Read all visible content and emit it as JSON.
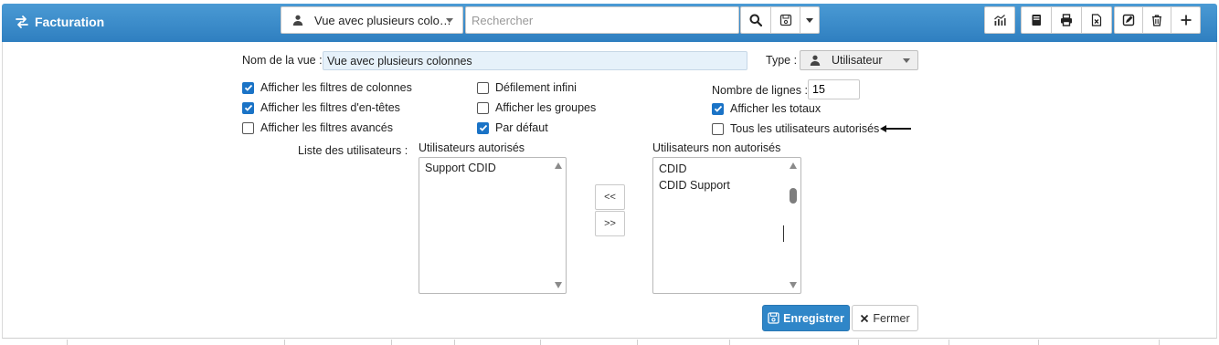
{
  "header": {
    "title": "Facturation",
    "view_selected": "Vue avec plusieurs colo…",
    "search_placeholder": "Rechercher",
    "icons": [
      "swap-arrows-icon",
      "user-icon",
      "search-icon",
      "save-view-icon",
      "chevron-down-icon",
      "chart-icon",
      "book-icon",
      "print-icon",
      "excel-export-icon",
      "edit-icon",
      "trash-icon",
      "plus-icon"
    ]
  },
  "form": {
    "view_name_label": "Nom de la vue :",
    "view_name_value": "Vue avec plusieurs colonnes",
    "type_label": "Type :",
    "type_value": "Utilisateur",
    "rows_label": "Nombre de lignes :",
    "rows_value": "15",
    "checkboxes_col1": [
      {
        "label": "Afficher les filtres de colonnes",
        "checked": true
      },
      {
        "label": "Afficher les filtres d'en-têtes",
        "checked": true
      },
      {
        "label": "Afficher les filtres avancés",
        "checked": false
      }
    ],
    "checkboxes_col2": [
      {
        "label": "Défilement infini",
        "checked": false
      },
      {
        "label": "Afficher les groupes",
        "checked": false
      },
      {
        "label": "Par défaut",
        "checked": true
      }
    ],
    "checkboxes_col3": [
      {
        "label": "Afficher les totaux",
        "checked": true
      },
      {
        "label": "Tous les utilisateurs autorisés",
        "checked": false
      }
    ],
    "users_list_label": "Liste des utilisateurs :",
    "authorized_label": "Utilisateurs autorisés",
    "authorized_users": [
      "Support CDID"
    ],
    "unauthorized_label": "Utilisateurs non autorisés",
    "unauthorized_users": [
      "CDID",
      "CDID Support"
    ],
    "move_left_label": "<<",
    "move_right_label": ">>",
    "save_label": "Enregistrer",
    "close_label": "Fermer"
  },
  "colors": {
    "header_bg": "#3b8bcb",
    "checkbox_checked": "#1a73c6",
    "save_button": "#2f86c8",
    "field_highlight": "#e6f1fa"
  }
}
